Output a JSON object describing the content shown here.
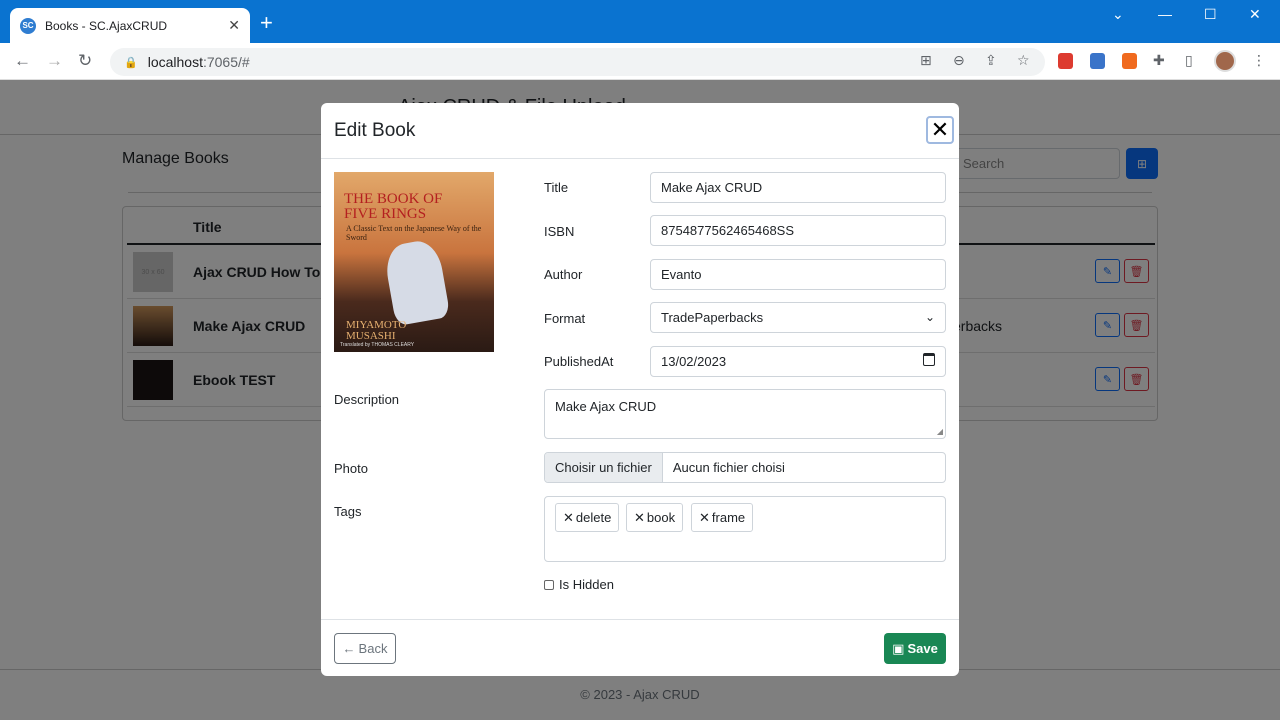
{
  "browser": {
    "tab_title": "Books - SC.AjaxCRUD",
    "favicon_text": "SC",
    "url_host": "localhost",
    "url_path": ":7065/#"
  },
  "page": {
    "app_title": "Ajax CRUD & File Upload",
    "manage_title": "Manage Books",
    "search_placeholder": "Search",
    "table_header": "Title",
    "rows": [
      {
        "title": "Ajax CRUD How To ! T",
        "thumb": "30 x 60",
        "extra": ""
      },
      {
        "title": "Make Ajax CRUD",
        "extra": "erbacks"
      },
      {
        "title": "Ebook TEST",
        "extra": ""
      }
    ],
    "footer": "© 2023 - Ajax CRUD"
  },
  "modal": {
    "title": "Edit Book",
    "book_cover": {
      "title_line1": "THE BOOK OF",
      "title_line2": "FIVE RINGS",
      "subtitle": "A Classic Text on the Japanese Way of the Sword",
      "author_line1": "MIYAMOTO",
      "author_line2": "MUSASHI",
      "translator": "Translated by THOMAS CLEARY"
    },
    "labels": {
      "title": "Title",
      "isbn": "ISBN",
      "author": "Author",
      "format": "Format",
      "published": "PublishedAt",
      "description": "Description",
      "photo": "Photo",
      "tags": "Tags"
    },
    "values": {
      "title": "Make Ajax CRUD",
      "isbn": "8754877562465468SS",
      "author": "Evanto",
      "format": "TradePaperbacks",
      "published": "13/02/2023",
      "description": "Make Ajax CRUD"
    },
    "file": {
      "button": "Choisir un fichier",
      "status": "Aucun fichier choisi"
    },
    "tags": [
      "delete",
      "book",
      "frame"
    ],
    "hidden_label": "Is Hidden",
    "back_label": "Back",
    "save_label": "Save"
  }
}
